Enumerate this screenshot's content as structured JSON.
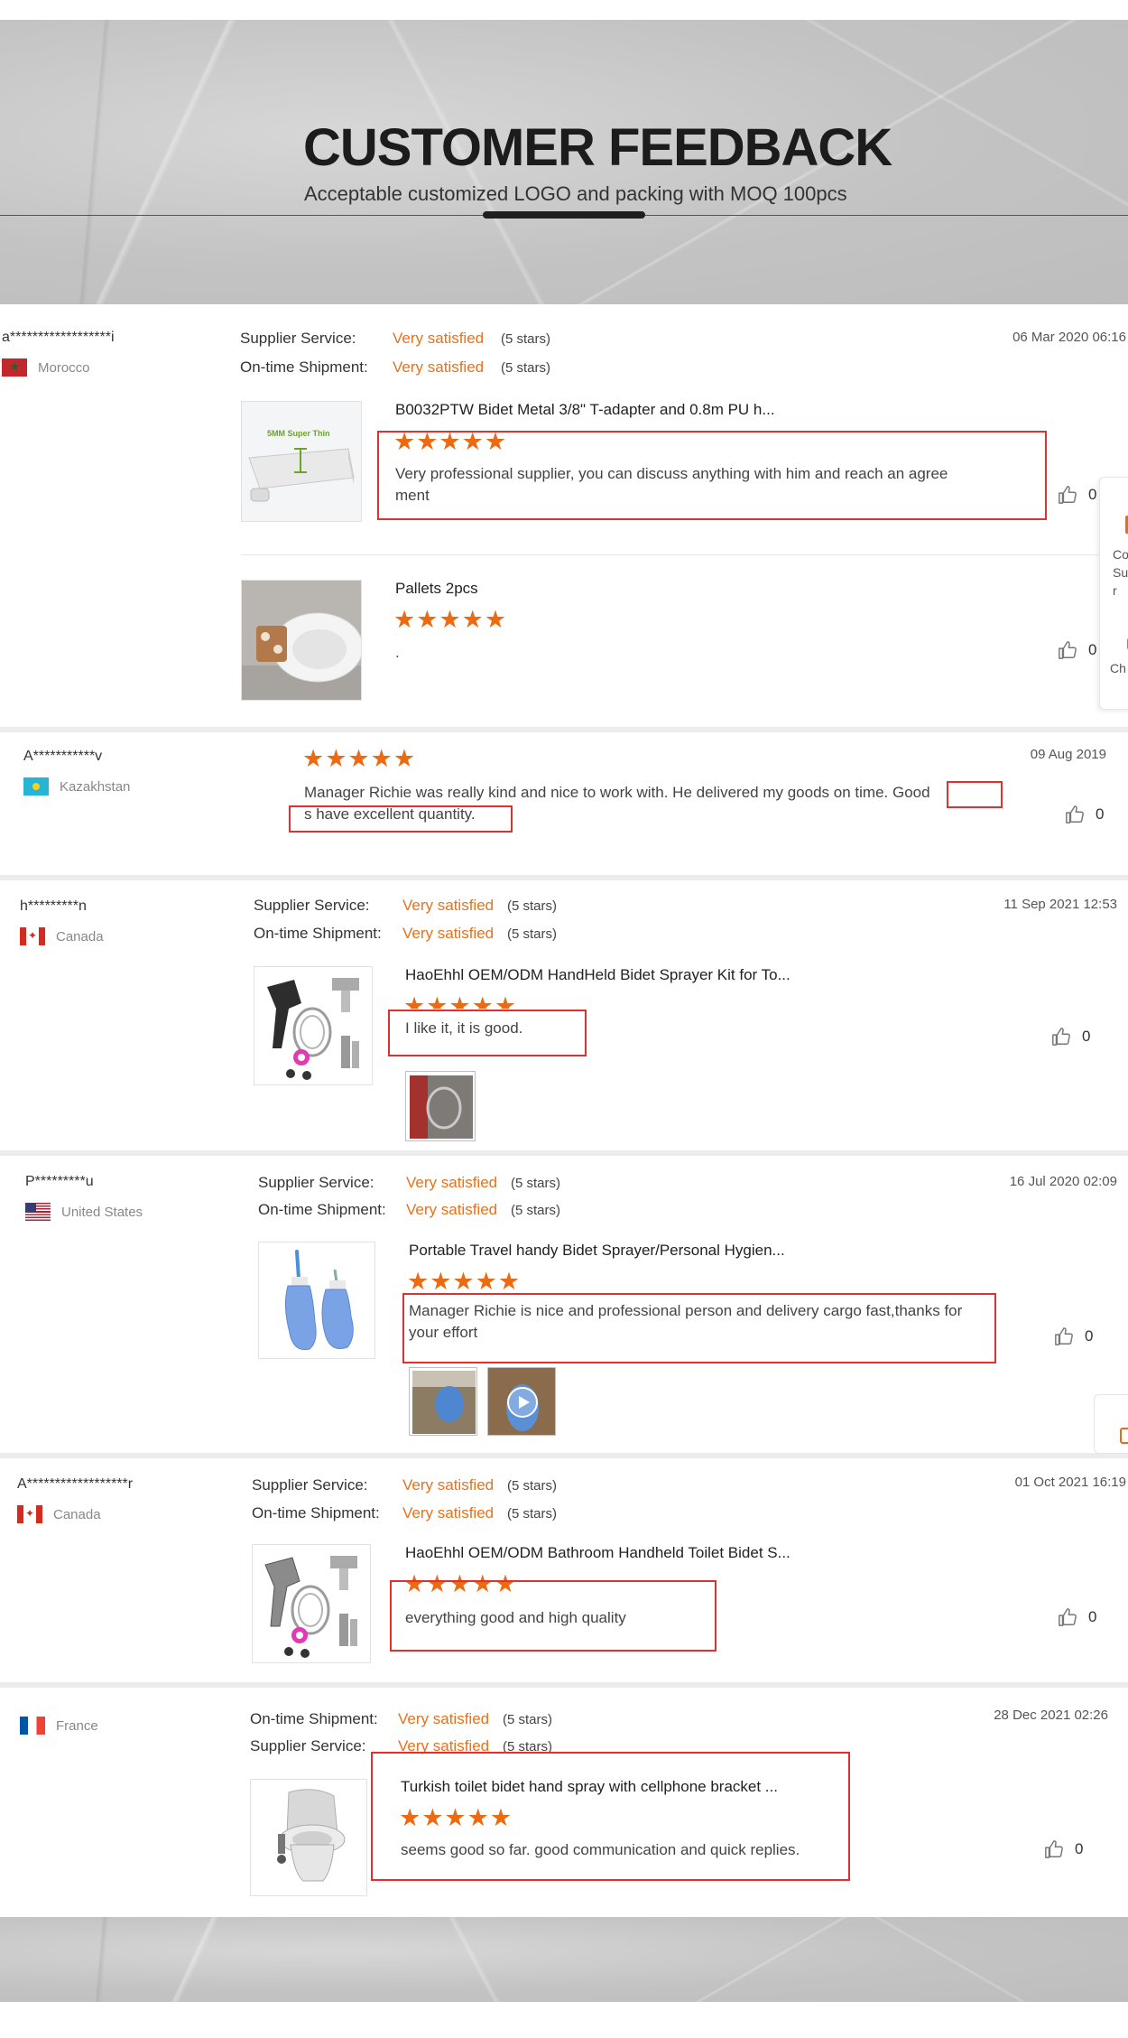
{
  "header": {
    "title": "CUSTOMER FEEDBACK",
    "subtitle": "Acceptable customized LOGO and packing with MOQ 100pcs"
  },
  "reviews": [
    {
      "buyer": "a******************i",
      "country": "Morocco",
      "date": "06 Mar 2020 06:16",
      "ratings": [
        {
          "label": "Supplier Service:",
          "value": "Very satisfied",
          "stars": "(5 stars)"
        },
        {
          "label": "On-time Shipment:",
          "value": "Very satisfied",
          "stars": "(5 stars)"
        }
      ],
      "items": [
        {
          "product": "B0032PTW Bidet Metal 3/8\" T-adapter and 0.8m PU h...",
          "thumb_text": "5MM Super Thin",
          "comment_line1": "Very professional supplier, you can discuss anything with him and reach an agree",
          "comment_line2": "ment",
          "likes": "0"
        },
        {
          "product": "Pallets 2pcs",
          "comment": ".",
          "likes": "0"
        }
      ]
    },
    {
      "buyer": "A***********v",
      "country": "Kazakhstan",
      "date": "09 Aug 2019",
      "comment_line1_a": "Manager Richie was really kind and nice to work with. He delivered my goods on time.",
      "comment_line1_b": "Good",
      "comment_line2": "s have excellent quantity.",
      "likes": "0"
    },
    {
      "buyer": "h*********n",
      "country": "Canada",
      "date": "11 Sep 2021 12:53",
      "ratings": [
        {
          "label": "Supplier Service:",
          "value": "Very satisfied",
          "stars": "(5 stars)"
        },
        {
          "label": "On-time Shipment:",
          "value": "Very satisfied",
          "stars": "(5 stars)"
        }
      ],
      "product": "HaoEhhl OEM/ODM HandHeld Bidet Sprayer Kit for To...",
      "comment": "I like it, it is good.",
      "likes": "0"
    },
    {
      "buyer": "P*********u",
      "country": "United States",
      "date": "16 Jul 2020 02:09",
      "ratings": [
        {
          "label": "Supplier Service:",
          "value": "Very satisfied",
          "stars": "(5 stars)"
        },
        {
          "label": "On-time Shipment:",
          "value": "Very satisfied",
          "stars": "(5 stars)"
        }
      ],
      "product": "Portable Travel handy Bidet Sprayer/Personal Hygien...",
      "comment_line1": "Manager Richie is nice and professional person and delivery cargo fast,thanks for",
      "comment_line2": "your effort",
      "likes": "0"
    },
    {
      "buyer": "A******************r",
      "country": "Canada",
      "date": "01 Oct 2021 16:19",
      "ratings": [
        {
          "label": "Supplier Service:",
          "value": "Very satisfied",
          "stars": "(5 stars)"
        },
        {
          "label": "On-time Shipment:",
          "value": "Very satisfied",
          "stars": "(5 stars)"
        }
      ],
      "product": "HaoEhhl OEM/ODM Bathroom Handheld Toilet Bidet S...",
      "comment": "everything good and high quality",
      "likes": "0"
    },
    {
      "buyer": "",
      "country": "France",
      "date": "28 Dec 2021 02:26",
      "ratings": [
        {
          "label": "On-time Shipment:",
          "value": "Very satisfied",
          "stars": "(5 stars)"
        },
        {
          "label": "Supplier Service:",
          "value": "Very satisfied",
          "stars": "(5 stars)"
        }
      ],
      "product": "Turkish toilet bidet hand spray with cellphone bracket ...",
      "comment": "seems good so far. good communication and quick replies.",
      "likes": "0"
    }
  ],
  "five_stars": "★★★★★",
  "side_widget": {
    "text": "Co Su r",
    "chat": "Ch"
  },
  "colors": {
    "accent": "#ec6a12",
    "highlight_box": "#e03131"
  }
}
